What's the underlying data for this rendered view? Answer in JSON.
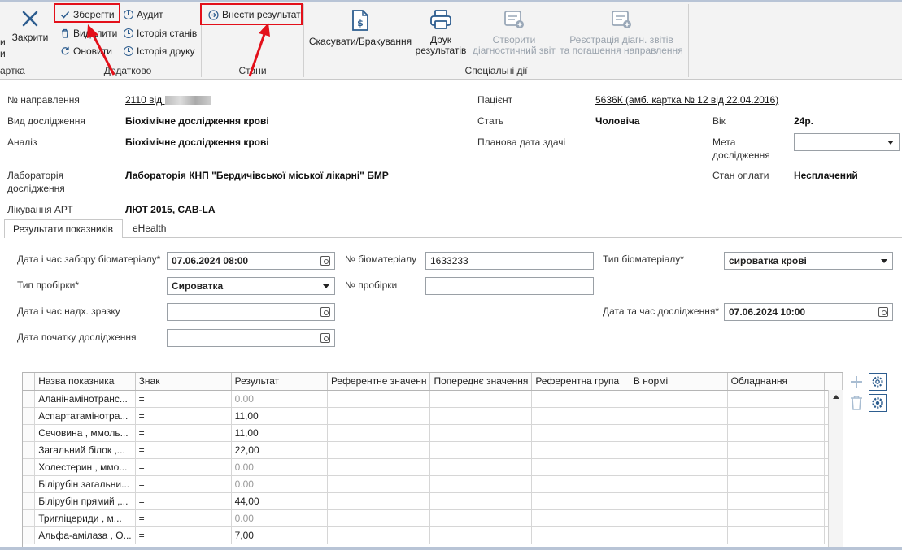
{
  "ribbon": {
    "close_left_fragment": "и",
    "close_label": "Закрити",
    "close_sub_left": "и",
    "group_kartka": "артка",
    "save_label": "Зберегти",
    "delete_label": "Видалити",
    "refresh_label": "Оновити",
    "audit_label": "Аудит",
    "history_states_label": "Історія станів",
    "history_print_label": "Історія друку",
    "group_extra": "Додатково",
    "enter_result_label": "Внести результат",
    "group_states": "Стани",
    "cancel_label": "Скасувати/Бракування",
    "print_label_1": "Друк",
    "print_label_2": "результатів",
    "create_diag_1": "Створити",
    "create_diag_2": "діагностичний звіт",
    "register_1": "Реєстрація діагн. звітів",
    "register_2": "та погашення направлення",
    "group_special": "Спеціальні дії"
  },
  "info": {
    "referral_label": "№ направлення",
    "referral_value": "2110 від",
    "research_type_label": "Вид дослідження",
    "research_type_value": "Біохімічне дослідження крові",
    "analysis_label": "Аналіз",
    "analysis_value": "Біохімічне дослідження крові",
    "lab_label_1": "Лабораторія",
    "lab_label_2": "дослідження",
    "lab_value": "Лабораторія КНП \"Бердичівської  міської лікарні\" БМР",
    "art_label": "Лікування АРТ",
    "art_value": "ЛЮТ 2015, CAB-LA",
    "patient_label": "Пацієнт",
    "patient_value": "5636К (амб. картка № 12 від 22.04.2016)",
    "sex_label": "Стать",
    "sex_value": "Чоловіча",
    "planned_date_label": "Планова дата здачі",
    "age_label": "Вік",
    "age_value": "24р.",
    "goal_label_1": "Мета",
    "goal_label_2": "дослідження",
    "goal_value": "",
    "payment_label": "Стан оплати",
    "payment_value": "Несплачений"
  },
  "tabs": [
    {
      "label": "Результати показників"
    },
    {
      "label": "eHealth"
    }
  ],
  "form": {
    "collect_dt_label": "Дата і час забору біоматеріалу*",
    "collect_dt_value": "07.06.2024 08:00",
    "bio_no_label": "№ біоматеріалу",
    "bio_no_value": "1633233",
    "bio_type_label": "Тип біоматеріалу*",
    "bio_type_value": "сироватка крові",
    "tube_type_label": "Тип пробірки*",
    "tube_type_value": "Сироватка",
    "tube_no_label": "№ пробірки",
    "tube_no_value": "",
    "arrival_dt_label": "Дата і час надх. зразку",
    "arrival_dt_value": "",
    "research_dt_label": "Дата та час дослідження*",
    "research_dt_value": "07.06.2024 10:00",
    "start_dt_label": "Дата початку дослідження",
    "start_dt_value": ""
  },
  "grid": {
    "columns": [
      "Назва показника",
      "Знак",
      "Результат",
      "Референтне значенн",
      "Попереднє значення",
      "Референтна група",
      "В нормі",
      "Обладнання"
    ],
    "rows": [
      {
        "name": "Аланінамінотранс...",
        "sign": "=",
        "result": "0.00",
        "gray": true
      },
      {
        "name": "Аспартатамінотра...",
        "sign": "=",
        "result": "11,00",
        "gray": false
      },
      {
        "name": "Сечовина  , ммоль...",
        "sign": "=",
        "result": "11,00",
        "gray": false
      },
      {
        "name": "Загальний білок ,...",
        "sign": "=",
        "result": "22,00",
        "gray": false
      },
      {
        "name": "Холестерин  , ммо...",
        "sign": "=",
        "result": "0.00",
        "gray": true
      },
      {
        "name": "Білірубін загальни...",
        "sign": "=",
        "result": "0.00",
        "gray": true
      },
      {
        "name": "Білірубін прямий  ,...",
        "sign": "=",
        "result": "44,00",
        "gray": false
      },
      {
        "name": "Тригліцериди  , м...",
        "sign": "=",
        "result": "0.00",
        "gray": true
      },
      {
        "name": "Альфа-амілаза  , О...",
        "sign": "=",
        "result": "7,00",
        "gray": false
      }
    ]
  },
  "colors": {
    "highlight": "#e3101a",
    "icon_blue": "#2d5d8f",
    "disabled": "#9aa3ad"
  }
}
